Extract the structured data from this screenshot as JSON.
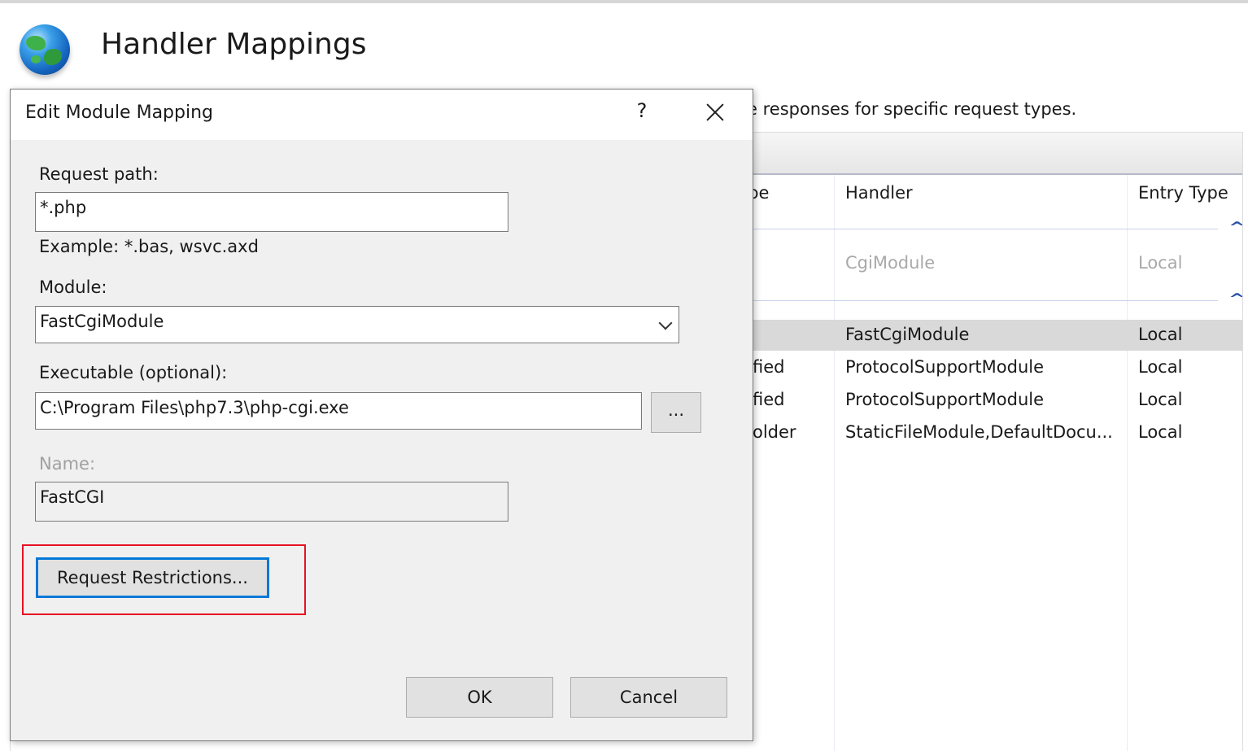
{
  "page": {
    "title": "Handler Mappings",
    "description": "e responses for specific request types."
  },
  "grid": {
    "columns": [
      "ɔe",
      "Handler",
      "Entry Type"
    ],
    "rows": [
      {
        "path_type": "",
        "handler": "CgiModule",
        "entry_type": "Local",
        "muted": true
      },
      {
        "path_type": "",
        "handler": "FastCgiModule",
        "entry_type": "Local",
        "selected": true
      },
      {
        "path_type": "fied",
        "handler": "ProtocolSupportModule",
        "entry_type": "Local"
      },
      {
        "path_type": "fied",
        "handler": "ProtocolSupportModule",
        "entry_type": "Local"
      },
      {
        "path_type": "older",
        "handler": "StaticFileModule,DefaultDocu...",
        "entry_type": "Local"
      }
    ]
  },
  "dialog": {
    "title": "Edit Module Mapping",
    "help_label": "?",
    "request_path_label": "Request path:",
    "request_path_value": "*.php",
    "example_text": "Example: *.bas, wsvc.axd",
    "module_label": "Module:",
    "module_value": "FastCgiModule",
    "executable_label": "Executable (optional):",
    "executable_value": "C:\\Program Files\\php7.3\\php-cgi.exe",
    "browse_label": "...",
    "name_label": "Name:",
    "name_value": "FastCGI",
    "restrictions_label": "Request Restrictions...",
    "ok_label": "OK",
    "cancel_label": "Cancel"
  },
  "colors": {
    "highlight": "#e81123",
    "focus": "#0078d7",
    "selected_row": "#d9d9d9"
  }
}
